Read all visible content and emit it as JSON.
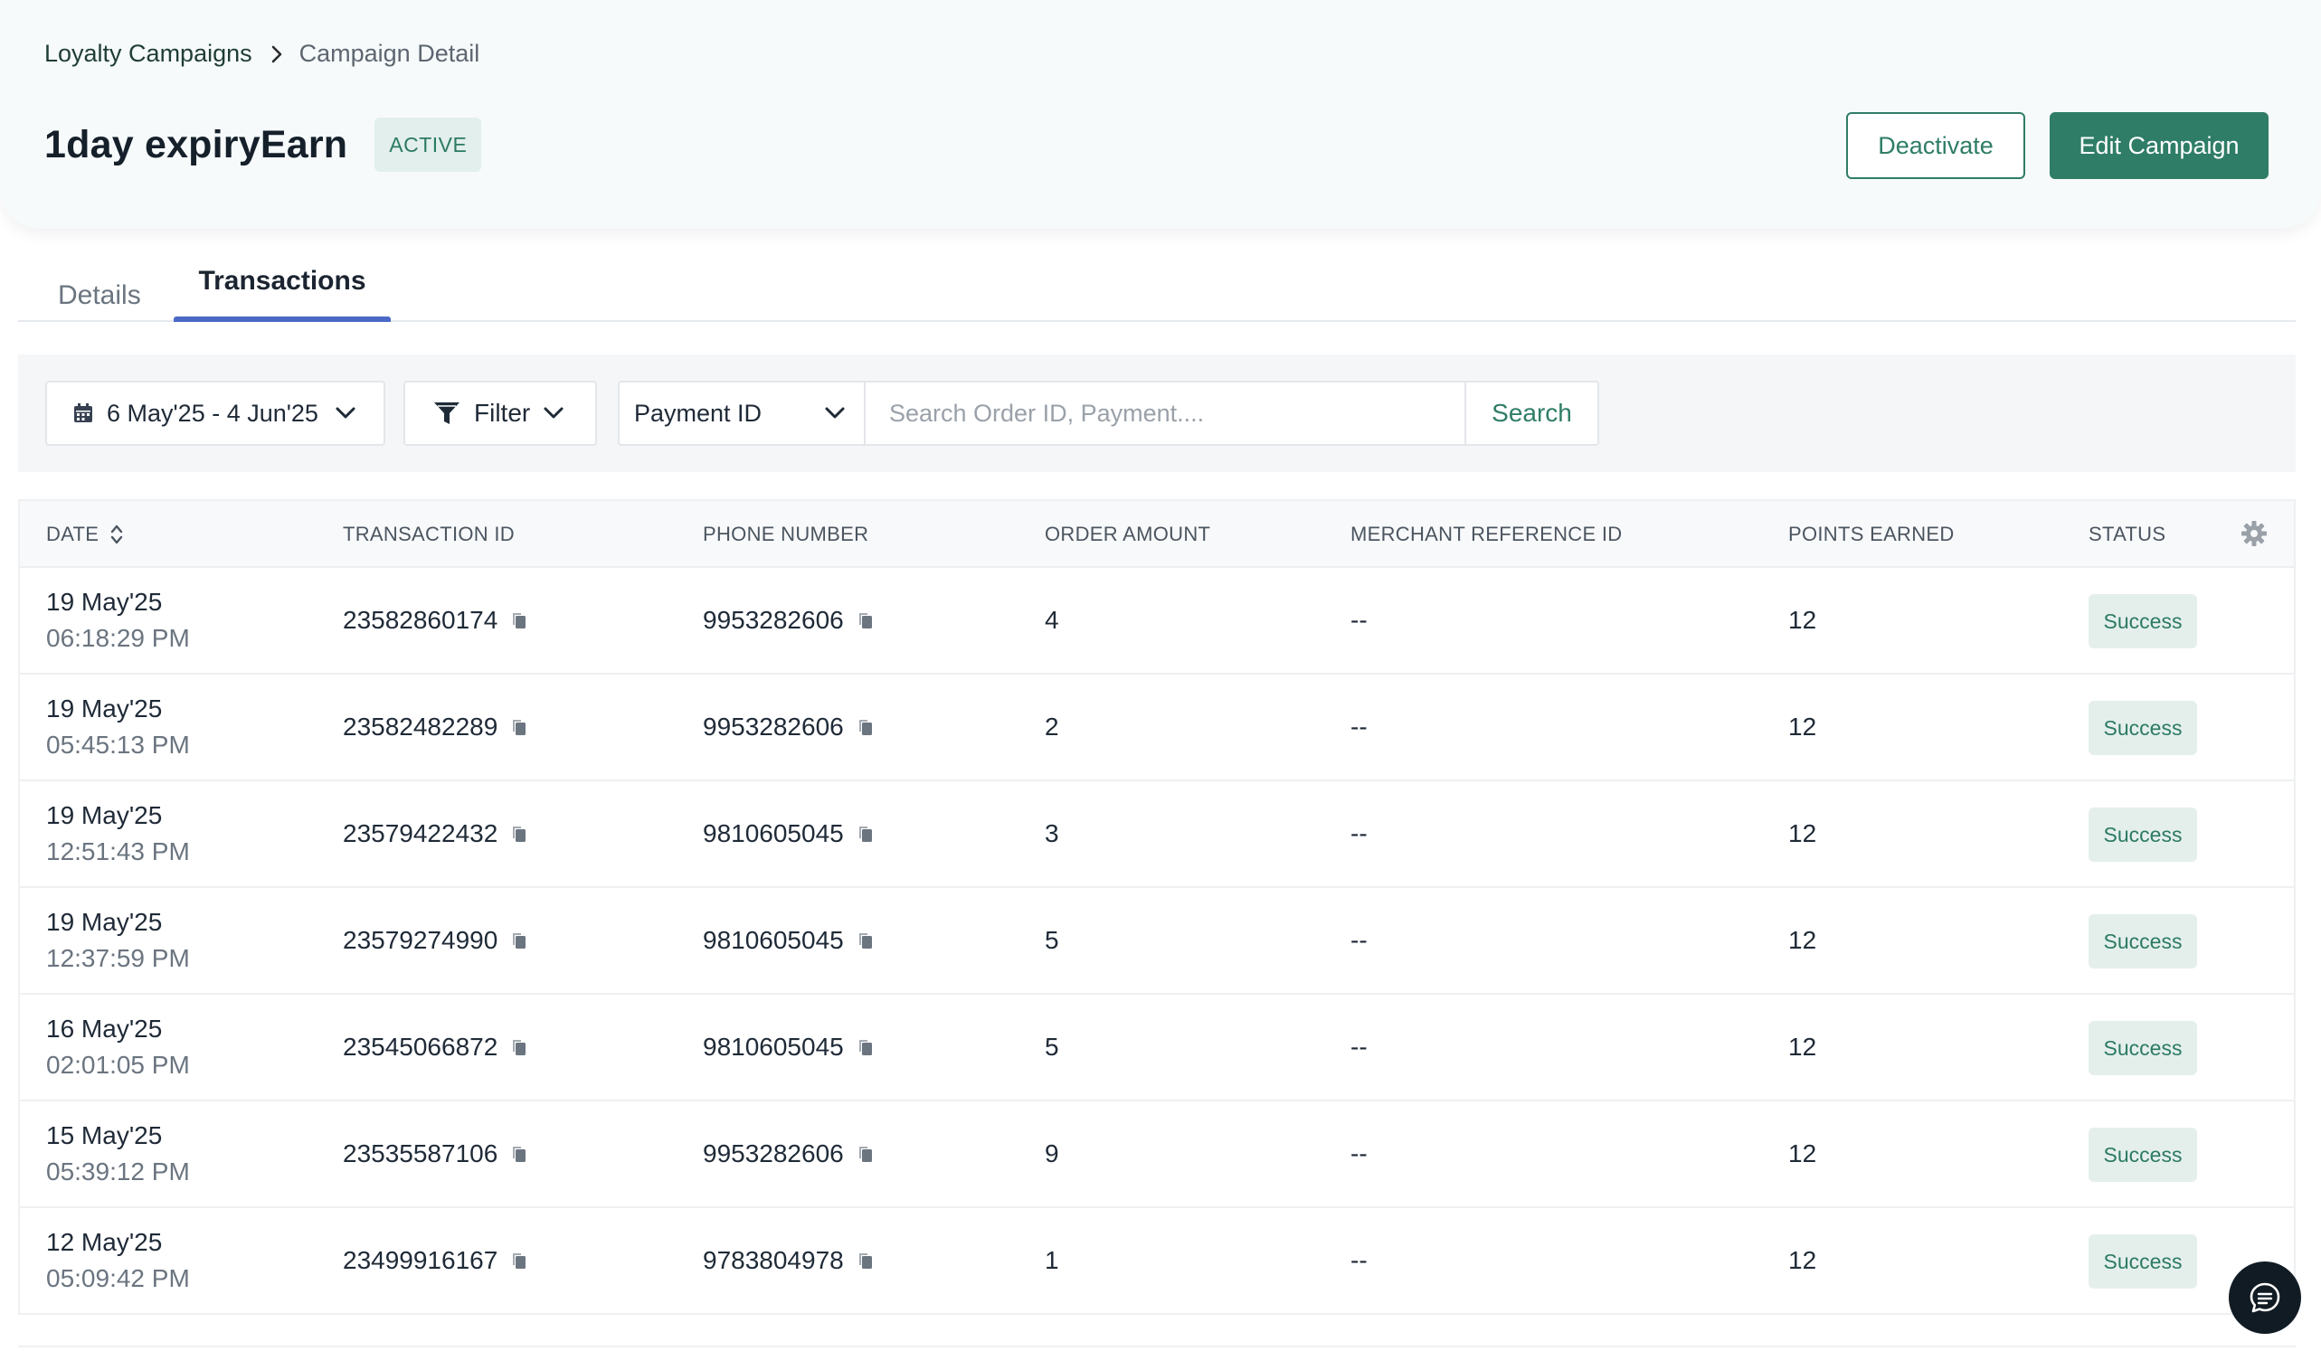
{
  "breadcrumb": {
    "root": "Loyalty Campaigns",
    "current": "Campaign Detail",
    "separator_icon": "chevron-right-icon"
  },
  "header": {
    "title": "1day expiryEarn",
    "status": "ACTIVE",
    "deactivate_label": "Deactivate",
    "edit_label": "Edit Campaign"
  },
  "tabs": [
    {
      "label": "Details",
      "active": false
    },
    {
      "label": "Transactions",
      "active": true
    }
  ],
  "filters": {
    "date_range": "6 May'25 - 4 Jun'25",
    "filter_label": "Filter",
    "search_field": "Payment ID",
    "search_placeholder": "Search Order ID, Payment....",
    "search_value": "",
    "search_button": "Search"
  },
  "table": {
    "columns": [
      "DATE",
      "TRANSACTION ID",
      "PHONE NUMBER",
      "ORDER AMOUNT",
      "MERCHANT REFERENCE ID",
      "POINTS EARNED",
      "STATUS"
    ],
    "rows": [
      {
        "date": "19 May'25",
        "time": "06:18:29 PM",
        "transaction_id": "23582860174",
        "phone": "9953282606",
        "amount": "4",
        "merchant_ref": "--",
        "points": "12",
        "status": "Success"
      },
      {
        "date": "19 May'25",
        "time": "05:45:13 PM",
        "transaction_id": "23582482289",
        "phone": "9953282606",
        "amount": "2",
        "merchant_ref": "--",
        "points": "12",
        "status": "Success"
      },
      {
        "date": "19 May'25",
        "time": "12:51:43 PM",
        "transaction_id": "23579422432",
        "phone": "9810605045",
        "amount": "3",
        "merchant_ref": "--",
        "points": "12",
        "status": "Success"
      },
      {
        "date": "19 May'25",
        "time": "12:37:59 PM",
        "transaction_id": "23579274990",
        "phone": "9810605045",
        "amount": "5",
        "merchant_ref": "--",
        "points": "12",
        "status": "Success"
      },
      {
        "date": "16 May'25",
        "time": "02:01:05 PM",
        "transaction_id": "23545066872",
        "phone": "9810605045",
        "amount": "5",
        "merchant_ref": "--",
        "points": "12",
        "status": "Success"
      },
      {
        "date": "15 May'25",
        "time": "05:39:12 PM",
        "transaction_id": "23535587106",
        "phone": "9953282606",
        "amount": "9",
        "merchant_ref": "--",
        "points": "12",
        "status": "Success"
      },
      {
        "date": "12 May'25",
        "time": "05:09:42 PM",
        "transaction_id": "23499916167",
        "phone": "9783804978",
        "amount": "1",
        "merchant_ref": "--",
        "points": "12",
        "status": "Success"
      }
    ]
  },
  "colors": {
    "brand": "#2f7d67",
    "tab_underline": "#4a69c6",
    "badge_bg": "#e4efec"
  }
}
